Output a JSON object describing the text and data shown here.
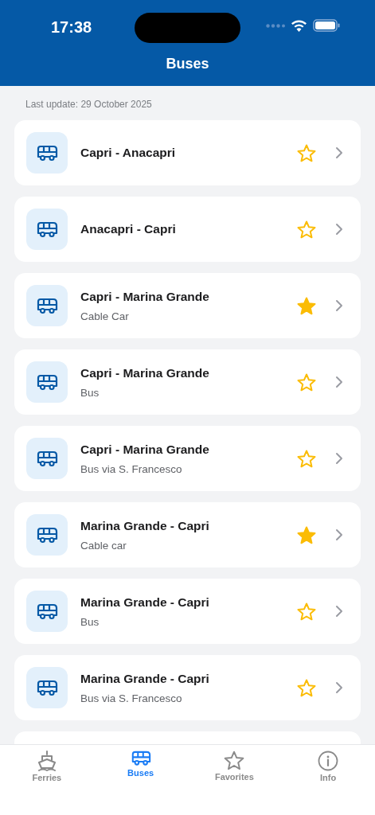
{
  "status_bar": {
    "time": "17:38"
  },
  "header": {
    "title": "Buses"
  },
  "last_update": "Last update: 29 October 2025",
  "routes": [
    {
      "title": "Capri - Anacapri",
      "favorite": false
    },
    {
      "title": "Anacapri - Capri",
      "favorite": false
    },
    {
      "title": "Capri - Marina Grande",
      "subtitle": "Cable Car",
      "favorite": true
    },
    {
      "title": "Capri - Marina Grande",
      "subtitle": "Bus",
      "favorite": false
    },
    {
      "title": "Capri - Marina Grande",
      "subtitle": "Bus via S. Francesco",
      "favorite": false
    },
    {
      "title": "Marina Grande - Capri",
      "subtitle": "Cable car",
      "favorite": true
    },
    {
      "title": "Marina Grande - Capri",
      "subtitle": "Bus",
      "favorite": false
    },
    {
      "title": "Marina Grande - Capri",
      "subtitle": "Bus via S. Francesco",
      "favorite": false
    }
  ],
  "tabs": [
    {
      "label": "Ferries",
      "kind": "ferry",
      "selected": false
    },
    {
      "label": "Buses",
      "kind": "bus",
      "selected": true
    },
    {
      "label": "Favorites",
      "kind": "star",
      "selected": false
    },
    {
      "label": "Info",
      "kind": "info",
      "selected": false
    }
  ]
}
